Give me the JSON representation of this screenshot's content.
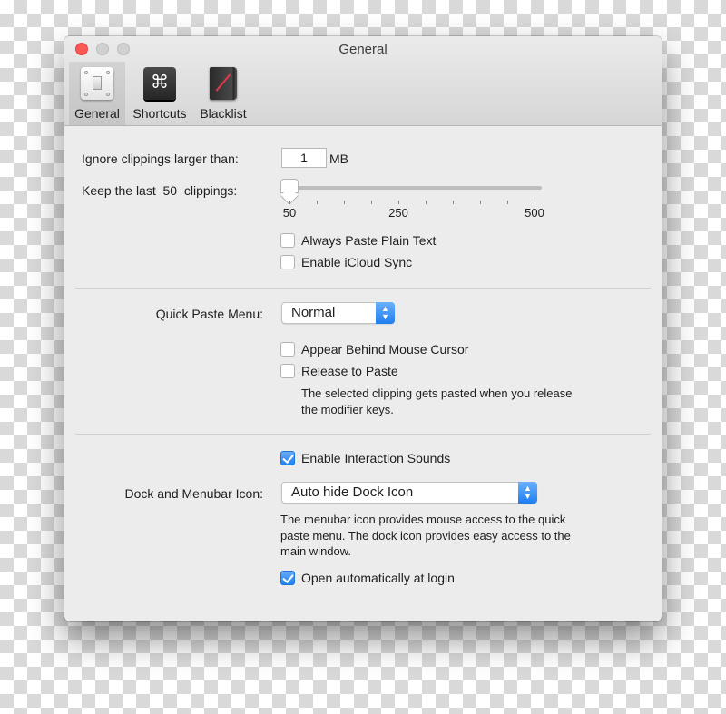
{
  "window": {
    "title": "General",
    "traffic_lights": [
      "close",
      "minimize",
      "zoom"
    ]
  },
  "toolbar": {
    "tabs": [
      {
        "label": "General",
        "icon": "light-switch-icon",
        "active": true
      },
      {
        "label": "Shortcuts",
        "icon": "command-key-icon",
        "glyph": "⌘",
        "active": false
      },
      {
        "label": "Blacklist",
        "icon": "blacklist-book-icon",
        "active": false
      }
    ]
  },
  "general": {
    "ignore_label": "Ignore clippings larger than:",
    "ignore_value": "1",
    "ignore_unit": "MB",
    "keep_label_prefix": "Keep the last",
    "keep_value": "50",
    "keep_label_suffix": "clippings:",
    "slider": {
      "min": 50,
      "max": 500,
      "value": 50,
      "tick_count": 10,
      "tick_labels": [
        "50",
        "250",
        "500"
      ]
    },
    "checkboxes": [
      {
        "label": "Always Paste Plain Text",
        "checked": false
      },
      {
        "label": "Enable iCloud Sync",
        "checked": false
      }
    ]
  },
  "quick_paste": {
    "label": "Quick Paste Menu:",
    "selected": "Normal",
    "checkboxes": [
      {
        "label": "Appear Behind Mouse Cursor",
        "checked": false
      },
      {
        "label": "Release to Paste",
        "checked": false
      }
    ],
    "release_help": "The selected clipping gets pasted when you release the modifier keys."
  },
  "dock": {
    "sounds_checkbox": {
      "label": "Enable Interaction Sounds",
      "checked": true
    },
    "label": "Dock and Menubar Icon:",
    "selected": "Auto hide Dock Icon",
    "help": "The menubar icon provides mouse access to the quick paste menu. The dock icon provides easy access to the main window.",
    "login_checkbox": {
      "label": "Open automatically at login",
      "checked": true
    }
  },
  "colors": {
    "accent": "#1f81f1",
    "close_button": "#fc5753",
    "window_bg": "#ececec"
  }
}
